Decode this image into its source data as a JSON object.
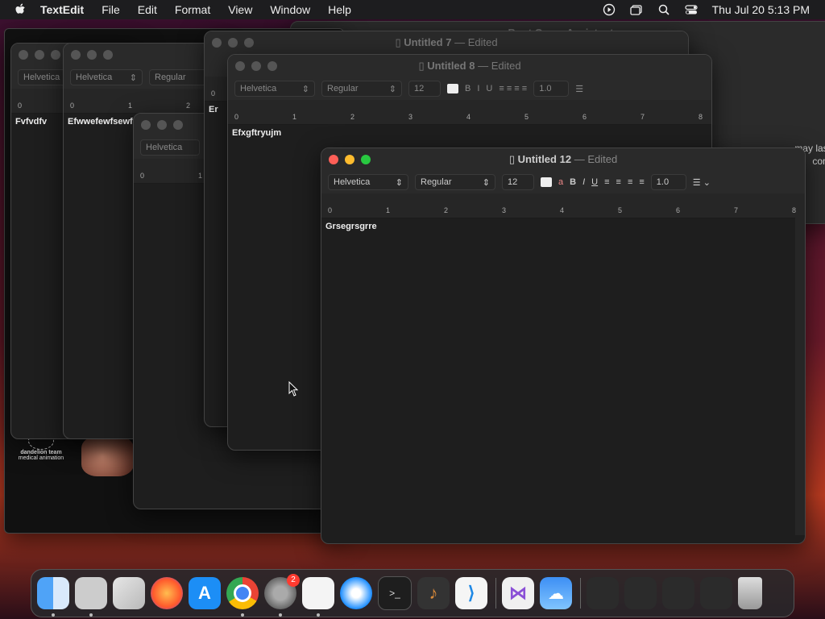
{
  "menubar": {
    "app": "TextEdit",
    "items": [
      "File",
      "Edit",
      "Format",
      "View",
      "Window",
      "Help"
    ],
    "clock": "Thu Jul 20  5:13 PM"
  },
  "bg_window": {
    "title": "Boot Camp Assistant",
    "text1": "may last",
    "text2": "com"
  },
  "windows": {
    "w7": {
      "title": "Untitled 7",
      "edited": "Edited"
    },
    "w8": {
      "title": "Untitled 8",
      "edited": "Edited",
      "text": "Efxgftryujm"
    },
    "w12": {
      "title": "Untitled 12",
      "edited": "Edited",
      "text": "Grsegrsgrre"
    },
    "wA": {
      "text": "Fvfvdfv"
    },
    "wB": {
      "text": "Efwwefewfsewf"
    },
    "wD": {
      "text": "Er"
    }
  },
  "toolbar": {
    "font": "Helvetica",
    "style": "Regular",
    "size": "12",
    "bold": "B",
    "italic": "I",
    "underline": "U",
    "spacing": "1.0"
  },
  "ruler_numbers": [
    "0",
    "1",
    "2",
    "3",
    "4",
    "5",
    "6",
    "7",
    "8"
  ],
  "desktop_logo": {
    "line1": "dandelion team",
    "line2": "medical animation"
  },
  "dock": {
    "items": [
      "Finder",
      "Migration Assistant",
      "Launchpad",
      "Firefox",
      "App Store",
      "Chrome",
      "System Settings",
      "TextEdit",
      "Safari",
      "Terminal",
      "GarageBand",
      "VS Code",
      "Visual Studio",
      "Weather",
      "Folder 1",
      "Folder 2",
      "Folder 3",
      "Folder 4",
      "Trash"
    ],
    "settings_badge": "2"
  }
}
